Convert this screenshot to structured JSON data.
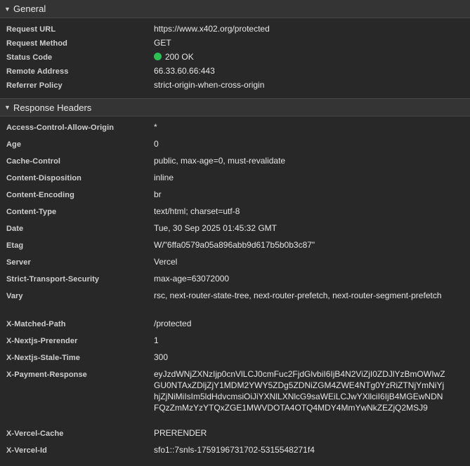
{
  "general": {
    "title": "General",
    "rows": [
      {
        "key": "Request URL",
        "value": "https://www.x402.org/protected"
      },
      {
        "key": "Request Method",
        "value": "GET"
      },
      {
        "key": "Status Code",
        "value": "200 OK"
      },
      {
        "key": "Remote Address",
        "value": "66.33.60.66:443"
      },
      {
        "key": "Referrer Policy",
        "value": "strict-origin-when-cross-origin"
      }
    ],
    "status_color": "#2bbf54"
  },
  "response_headers": {
    "title": "Response Headers",
    "rows": [
      {
        "key": "Access-Control-Allow-Origin",
        "value": "*"
      },
      {
        "key": "Age",
        "value": "0"
      },
      {
        "key": "Cache-Control",
        "value": "public, max-age=0, must-revalidate"
      },
      {
        "key": "Content-Disposition",
        "value": "inline"
      },
      {
        "key": "Content-Encoding",
        "value": "br"
      },
      {
        "key": "Content-Type",
        "value": "text/html; charset=utf-8"
      },
      {
        "key": "Date",
        "value": "Tue, 30 Sep 2025 01:45:32 GMT"
      },
      {
        "key": "Etag",
        "value": "W/\"6ffa0579a05a896abb9d617b5b0b3c87\""
      },
      {
        "key": "Server",
        "value": "Vercel"
      },
      {
        "key": "Strict-Transport-Security",
        "value": "max-age=63072000"
      },
      {
        "key": "Vary",
        "value": "rsc, next-router-state-tree, next-router-prefetch, next-router-segment-prefetch"
      },
      {
        "key": "X-Matched-Path",
        "value": "/protected"
      },
      {
        "key": "X-Nextjs-Prerender",
        "value": "1"
      },
      {
        "key": "X-Nextjs-Stale-Time",
        "value": "300"
      },
      {
        "key": "X-Payment-Response",
        "value": "eyJzdWNjZXNzIjp0cnVlLCJ0cmFuc2FjdGlvbiI6IjB4N2ViZjI0ZDJlYzBmOWIwZGU0NTAxZDljZjY1MDM2YWY5ZDg5ZDNiZGM4ZWE4NTg0YzRiZTNjYmNiYjhjZjNiMiIsIm5ldHdvcmsiOiJiYXNlLXNlcG9saWEiLCJwYXllciI6IjB4MGEwNDNFQzZmMzYzYTQxZGE1MWVDOTA4OTQ4MDY4MmYwNkZEZjQ2MSJ9"
      },
      {
        "key": "X-Vercel-Cache",
        "value": "PRERENDER"
      },
      {
        "key": "X-Vercel-Id",
        "value": "sfo1::7snls-1759196731702-5315548271f4"
      }
    ]
  }
}
